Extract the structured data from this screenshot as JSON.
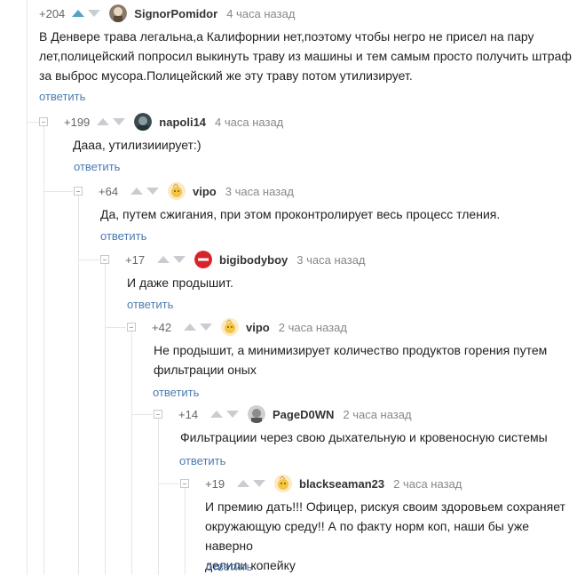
{
  "comments": [
    {
      "rating": "+204",
      "user": "SignorPomidor",
      "time": "4 часа назад",
      "lines": [
        "В Денвере трава легальна,а Калифорнии нет,поэтому чтобы негро не присел на пару",
        "лет,полицейский попросил выкинуть траву из машины и тем самым просто получить штраф",
        "за выброс мусора.Полицейский же эту траву потом утилизирует."
      ],
      "reply": "ответить"
    },
    {
      "rating": "+199",
      "user": "napoli14",
      "time": "4 часа назад",
      "lines": [
        "Дааа, утилизииирует:)"
      ],
      "reply": "ответить"
    },
    {
      "rating": "+64",
      "user": "vipo",
      "time": "3 часа назад",
      "lines": [
        "Да, путем сжигания, при этом проконтролирует весь процесс тления."
      ],
      "reply": "ответить"
    },
    {
      "rating": "+17",
      "user": "bigibodyboy",
      "time": "3 часа назад",
      "lines": [
        "И даже продышит."
      ],
      "reply": "ответить"
    },
    {
      "rating": "+42",
      "user": "vipo",
      "time": "2 часа назад",
      "lines": [
        "Не продышит, а минимизирует количество продуктов горения путем",
        "фильтрации оных"
      ],
      "reply": "ответить"
    },
    {
      "rating": "+14",
      "user": "PageD0WN",
      "time": "2 часа назад",
      "lines": [
        "Фильтрациии через свою дыхательную и кровеносную системы"
      ],
      "reply": "ответить"
    },
    {
      "rating": "+19",
      "user": "blackseaman23",
      "time": "2 часа назад",
      "lines": [
        "И премию дать!!! Офицер, рискуя своим здоровьем сохраняет",
        "окружающую среду!! А по факту норм коп, наши бы уже наверно",
        "делили копейку"
      ],
      "reply": "ответить"
    }
  ],
  "colors": {
    "accent": "#58a0c8",
    "link": "#4c7bb2",
    "arrow": "#c9cdd2",
    "stop": "#d8232a"
  }
}
